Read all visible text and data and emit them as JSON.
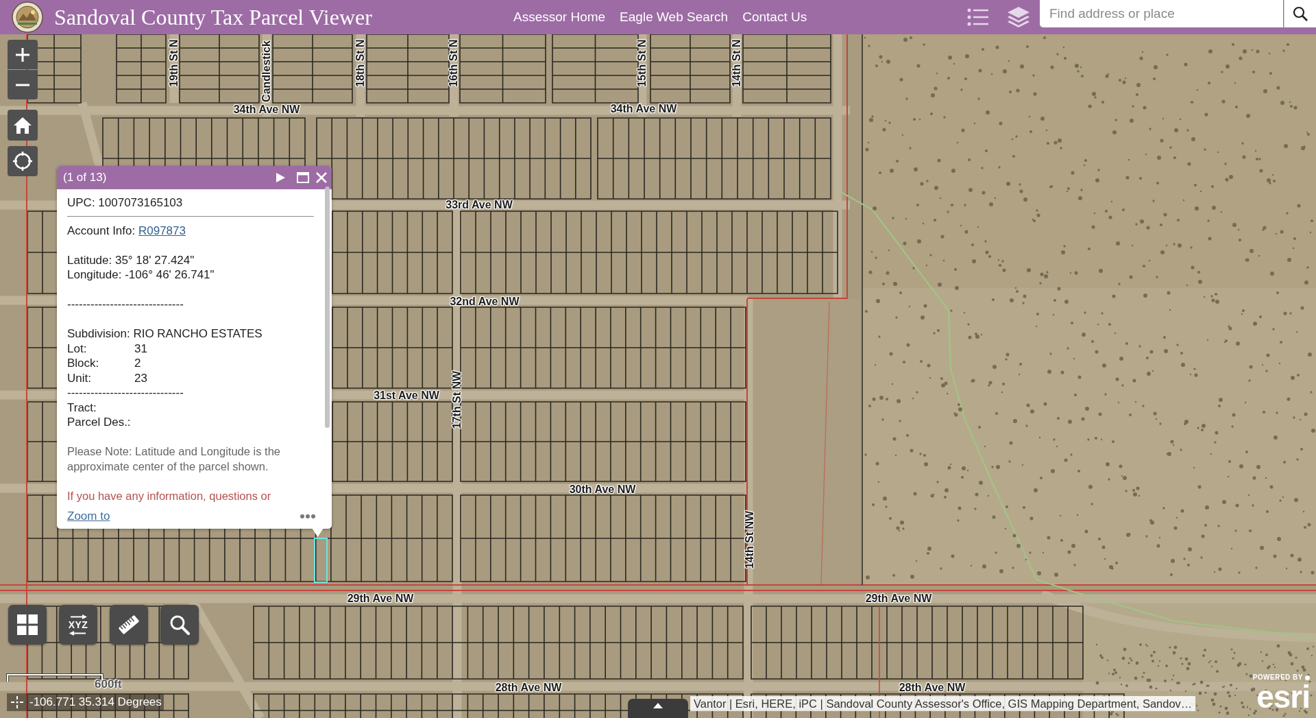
{
  "header": {
    "title": "Sandoval County Tax Parcel Viewer",
    "nav_links": [
      "Assessor Home",
      "Eagle Web Search",
      "Contact Us"
    ],
    "search": {
      "placeholder": "Find address or place"
    }
  },
  "map": {
    "street_labels": [
      {
        "text": "34th Ave NW",
        "kind": "horizontal"
      },
      {
        "text": "34th Ave NW",
        "kind": "horizontal"
      },
      {
        "text": "33rd Ave NW",
        "kind": "horizontal"
      },
      {
        "text": "32nd Ave NW",
        "kind": "horizontal"
      },
      {
        "text": "31st Ave NW",
        "kind": "horizontal"
      },
      {
        "text": "30th Ave NW",
        "kind": "horizontal"
      },
      {
        "text": "29th Ave NW",
        "kind": "horizontal"
      },
      {
        "text": "29th Ave NW",
        "kind": "horizontal"
      },
      {
        "text": "28th Ave NW",
        "kind": "horizontal"
      },
      {
        "text": "28th Ave NW",
        "kind": "horizontal"
      },
      {
        "text": "19th St N",
        "kind": "vertical"
      },
      {
        "text": "Candlestick",
        "kind": "vertical"
      },
      {
        "text": "18th St N",
        "kind": "vertical"
      },
      {
        "text": "16th St N",
        "kind": "vertical"
      },
      {
        "text": "15th St N",
        "kind": "vertical"
      },
      {
        "text": "14th St N",
        "kind": "vertical"
      },
      {
        "text": "17th St NW",
        "kind": "vertical"
      },
      {
        "text": "14th St NW",
        "kind": "vertical"
      }
    ]
  },
  "popup": {
    "title": "(1 of 13)",
    "upc": "UPC: 1007073165103",
    "account": {
      "label": "Account Info:",
      "link": "R097873"
    },
    "coordinates": [
      "Latitude: 35° 18' 27.424\"",
      "Longitude: -106° 46' 26.741\""
    ],
    "separator": "------------------------------",
    "subdivision": "Subdivision: RIO RANCHO ESTATES",
    "fields": [
      {
        "label": "Lot:",
        "value": "31"
      },
      {
        "label": "Block:",
        "value": "2"
      },
      {
        "label": "Unit:",
        "value": "23"
      }
    ],
    "separator_2": "------------------------------",
    "extra_fields": [
      "Tract:",
      "Parcel Des.:"
    ],
    "note": "Please Note: Latitude and Longitude is the approximate center of the parcel shown.",
    "contact_note": "If you have any information, questions or",
    "zoom_link": "Zoom to"
  },
  "toolbar": [
    {
      "kind": "grid"
    },
    {
      "kind": "xyz",
      "label": "XYZ"
    },
    {
      "kind": "ruler"
    },
    {
      "kind": "search"
    }
  ],
  "scale_bar": {
    "label": "600ft"
  },
  "coordinates": {
    "text": "-106.771 35.314 Degrees"
  },
  "attribution": {
    "text": "Vantor | Esri, HERE, iPC | Sandoval County Assessor's Office, GIS Mapping Department, Sandov…"
  },
  "logo": {
    "tagline": "POWERED BY",
    "wordmark": "esri"
  }
}
